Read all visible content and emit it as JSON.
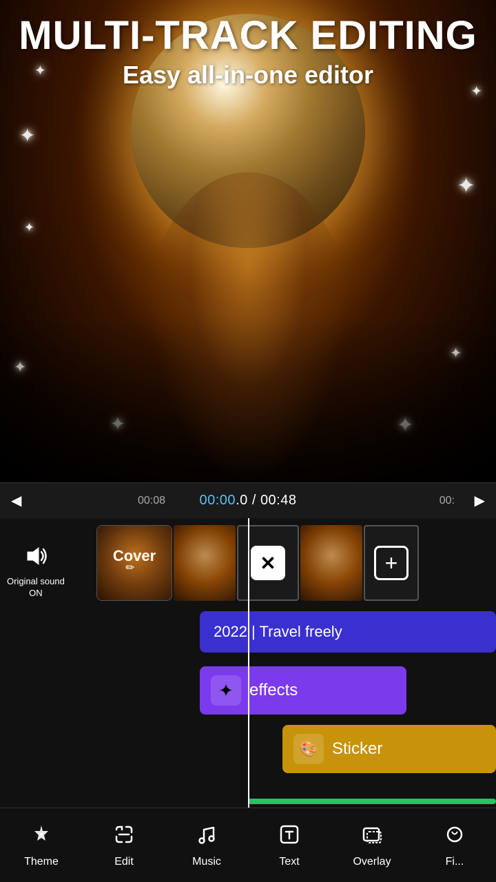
{
  "header": {
    "main_title": "MULTI-TRACK EDITING",
    "sub_title": "Easy all-in-one editor"
  },
  "timeline": {
    "current_time": "00:00",
    "current_frame": ".0",
    "total_time": "00:48",
    "marker1": "00:08",
    "marker2": "00:"
  },
  "sound": {
    "label_line1": "Original sound",
    "label_line2": "ON"
  },
  "tracks": {
    "cover_label": "Cover",
    "text_content": "2022 | Travel freely",
    "effects_label": "effects",
    "sticker_label": "Sticker"
  },
  "bottom_nav": {
    "items": [
      {
        "id": "theme",
        "label": "Theme",
        "icon": "✦"
      },
      {
        "id": "edit",
        "label": "Edit",
        "icon": "✂"
      },
      {
        "id": "music",
        "label": "Music",
        "icon": "♪"
      },
      {
        "id": "text",
        "label": "Text",
        "icon": "T"
      },
      {
        "id": "overlay",
        "label": "Overlay",
        "icon": "⊡"
      },
      {
        "id": "filter",
        "label": "Fi...",
        "icon": "◈"
      }
    ]
  }
}
